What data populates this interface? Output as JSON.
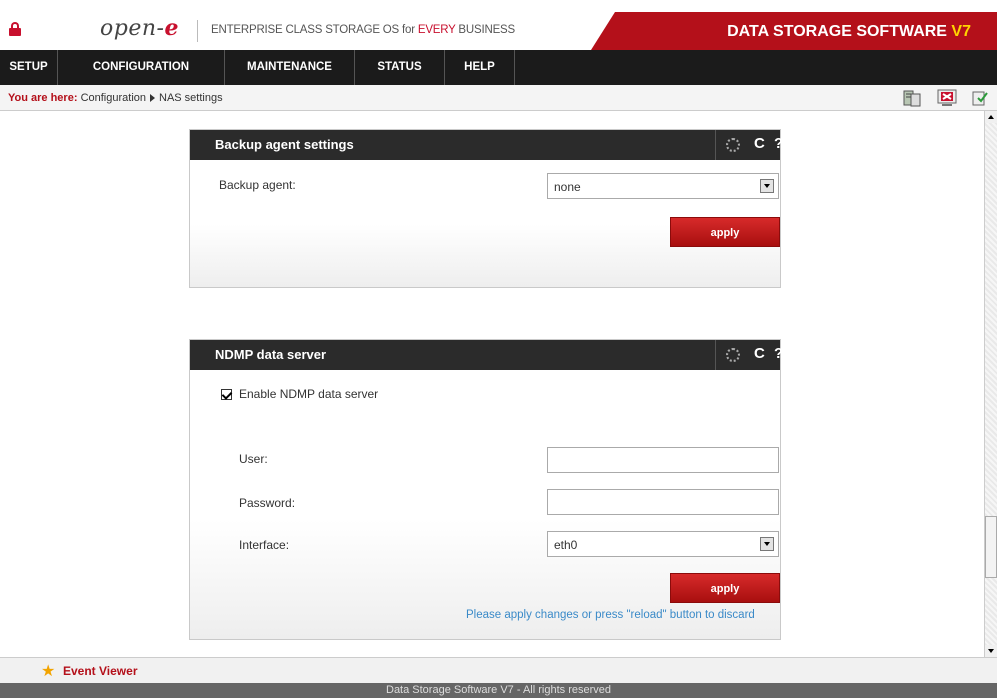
{
  "header": {
    "logo": "open-",
    "logo_accent": "e",
    "tagline_prefix": "ENTERPRISE CLASS STORAGE OS for ",
    "tagline_highlight": "EVERY",
    "tagline_suffix": " BUSINESS",
    "product_title": "DATA STORAGE SOFTWARE ",
    "product_version": "V7"
  },
  "menu": {
    "items": [
      {
        "label": "SETUP"
      },
      {
        "label": "CONFIGURATION"
      },
      {
        "label": "MAINTENANCE"
      },
      {
        "label": "STATUS"
      },
      {
        "label": "HELP"
      }
    ]
  },
  "breadcrumb": {
    "prefix": "You are here:",
    "path1": "Configuration",
    "path2": "NAS settings"
  },
  "backup_panel": {
    "title": "Backup agent settings",
    "agent_label": "Backup agent:",
    "agent_value": "none",
    "apply_label": "apply"
  },
  "ndmp_panel": {
    "title": "NDMP data server",
    "enable_label": "Enable NDMP data server",
    "user_label": "User:",
    "user_value": "",
    "password_label": "Password:",
    "password_value": "",
    "interface_label": "Interface:",
    "interface_value": "eth0",
    "apply_label": "apply",
    "note": "Please apply changes or press \"reload\" button to discard"
  },
  "panel_icons": {
    "reload": "C",
    "help": "?"
  },
  "event_viewer": {
    "label": "Event Viewer"
  },
  "footer": {
    "text": "Data Storage Software V7 - All rights reserved"
  },
  "colors": {
    "brand_red": "#b4101a",
    "accent_yellow": "#ffd400",
    "note_blue": "#3a8ac8"
  }
}
